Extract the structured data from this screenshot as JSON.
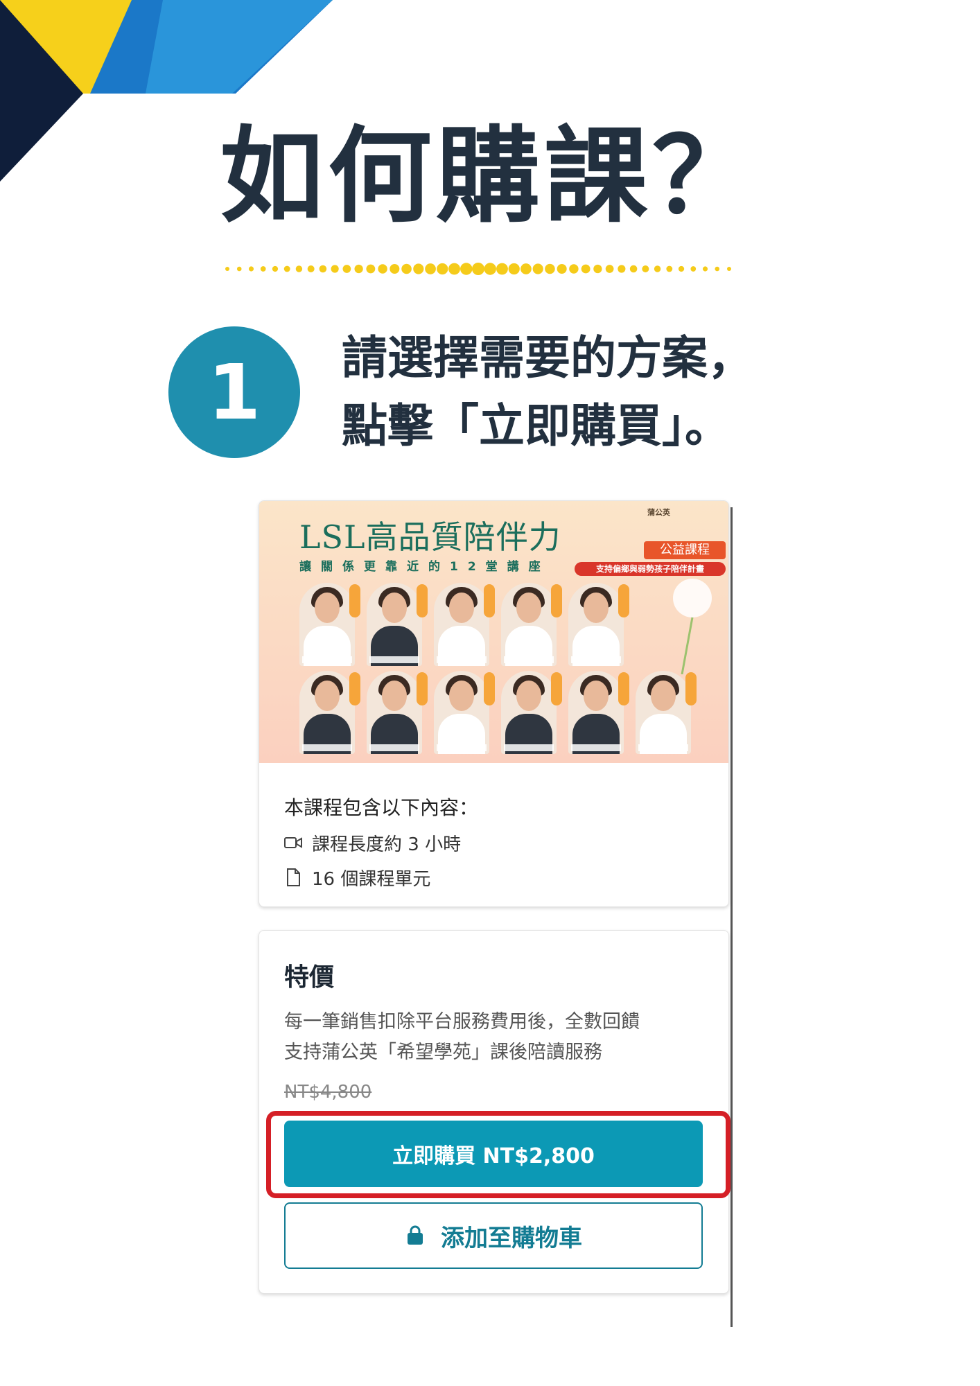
{
  "page": {
    "title": "如何購課？",
    "step": {
      "number": "1",
      "line1": "請選擇需要的方案，",
      "line2": "點擊「立即購買」。"
    }
  },
  "course_card": {
    "banner": {
      "title": "LSL高品質陪伴力",
      "subtitle": "讓關係更靠近的12堂講座",
      "tag_primary": "公益課程",
      "tag_secondary": "支持偏鄉與弱勢孩子陪伴計畫",
      "logo_text": "蒲公英"
    },
    "includes_label": "本課程包含以下內容：",
    "items": [
      {
        "icon": "video-icon",
        "text": "課程長度約 3 小時"
      },
      {
        "icon": "document-icon",
        "text": "16 個課程單元"
      }
    ]
  },
  "pricing_card": {
    "title": "特價",
    "description_line1": "每一筆銷售扣除平台服務費用後，全數回饋",
    "description_line2": "支持蒲公英「希望學苑」課後陪讀服務",
    "original_price": "NT$4,800",
    "buy_button": "立即購買 NT$2,800",
    "cart_button": "添加至購物車"
  },
  "colors": {
    "accent": "#0c99b5",
    "step_circle": "#1f8fae",
    "highlight": "#d51f26",
    "title": "#22303f",
    "dots": "#f5cb1a"
  }
}
